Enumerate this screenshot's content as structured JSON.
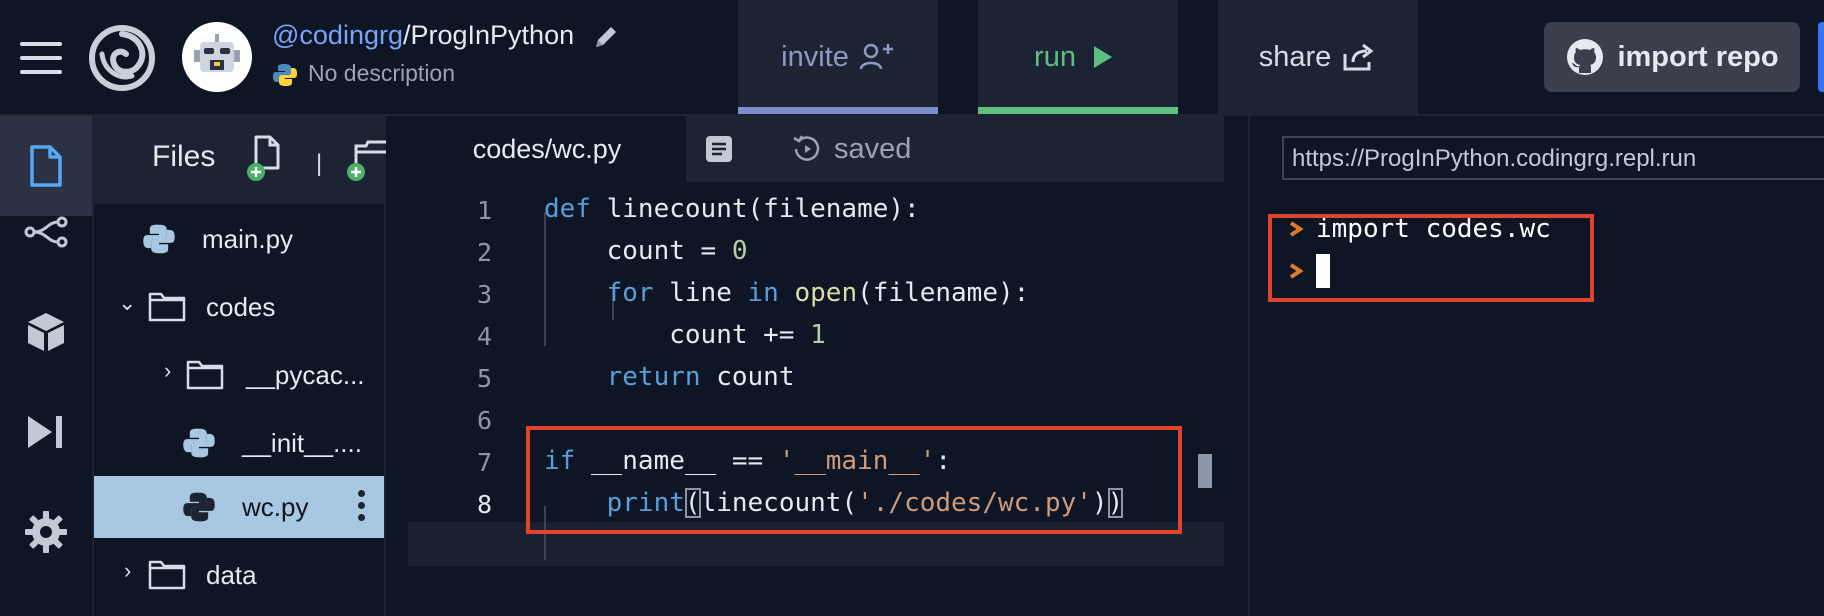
{
  "header": {
    "repo_owner": "@codingrg",
    "repo_separator": "/",
    "repo_name": "ProgInPython",
    "description": "No description",
    "buttons": {
      "invite": "invite",
      "run": "run",
      "share": "share",
      "import": "import repo"
    }
  },
  "sidebar": {
    "files_title": "Files",
    "divider": "|",
    "tree": [
      {
        "name": "main.py",
        "type": "python-file"
      },
      {
        "name": "codes",
        "type": "folder",
        "expanded": true
      },
      {
        "name": "__pycac...",
        "type": "folder",
        "expanded": false
      },
      {
        "name": "__init__....",
        "type": "python-file"
      },
      {
        "name": "wc.py",
        "type": "python-file",
        "selected": true
      },
      {
        "name": "data",
        "type": "folder",
        "expanded": false
      }
    ]
  },
  "editor": {
    "tab": "codes/wc.py",
    "status": "saved",
    "line_numbers": [
      "1",
      "2",
      "3",
      "4",
      "5",
      "6",
      "7",
      "8"
    ],
    "code": {
      "l1_kw": "def",
      "l1_rest": " linecount(filename):",
      "l2_indent": "    ",
      "l2_text": "count = ",
      "l2_num": "0",
      "l3_indent": "    ",
      "l3_kw1": "for",
      "l3_mid": " line ",
      "l3_kw2": "in",
      "l3_sp": " ",
      "l3_fn": "open",
      "l3_rest": "(filename):",
      "l4_indent": "        ",
      "l4_text": "count += ",
      "l4_num": "1",
      "l5_indent": "    ",
      "l5_kw": "return",
      "l5_rest": " count",
      "l7_kw": "if",
      "l7_mid": " __name__ == ",
      "l7_str": "'__main__'",
      "l7_end": ":",
      "l8_indent": "    ",
      "l8_fn": "print",
      "l8_open": "(",
      "l8_call": "linecount(",
      "l8_str": "'./codes/wc.py'",
      "l8_close1": ")",
      "l8_close2": ")"
    }
  },
  "console": {
    "url": "https://ProgInPython.codingrg.repl.run",
    "lines": [
      "import codes.wc",
      ""
    ]
  },
  "colors": {
    "background": "#0e1525",
    "panel": "#1c2333",
    "run_accent": "#5fbf83",
    "invite_accent": "#7e8ecc",
    "annotation_red": "#e0452b",
    "selected_file": "#a8c7e2"
  },
  "icons": {
    "menu": "hamburger-icon",
    "logo": "replit-logo",
    "invite": "add-person-icon",
    "run": "play-icon",
    "share": "share-icon",
    "import": "github-icon",
    "rail": [
      "files-icon",
      "version-control-icon",
      "packages-icon",
      "debugger-icon",
      "settings-icon"
    ]
  }
}
